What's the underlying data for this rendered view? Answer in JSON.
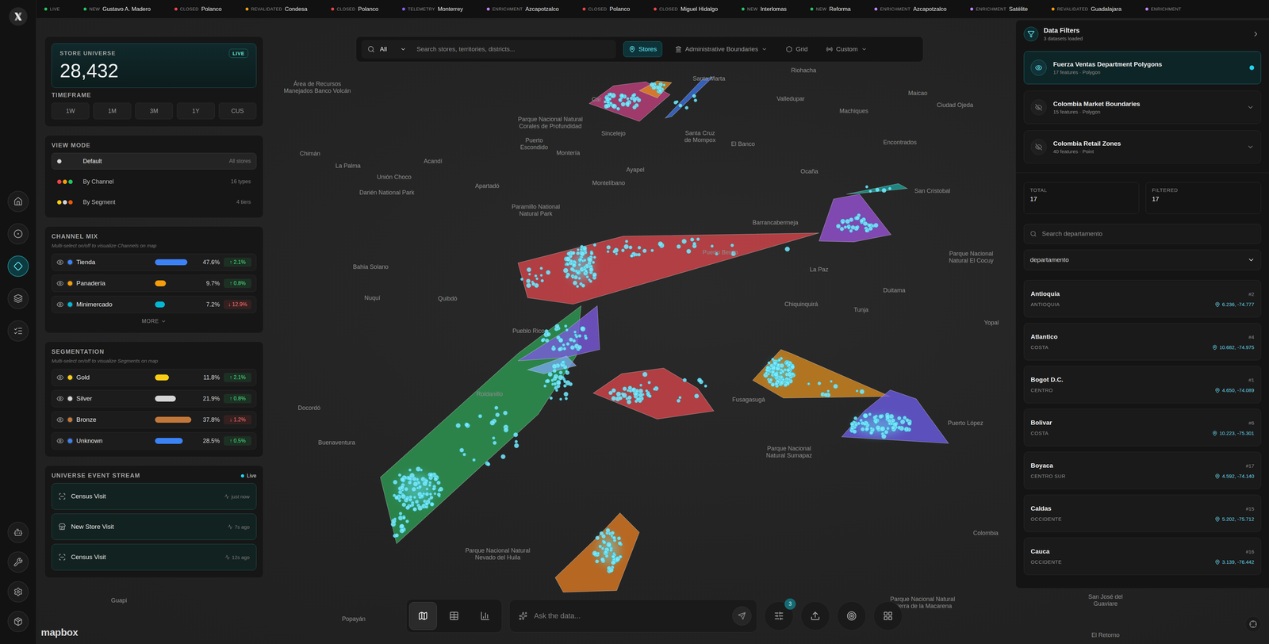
{
  "rail": [
    {
      "selected": false
    },
    {
      "selected": false
    },
    {
      "selected": true
    },
    {
      "selected": false
    },
    {
      "selected": false
    },
    {
      "selected": false
    },
    {
      "selected": false
    },
    {
      "selected": false
    },
    {
      "selected": false
    }
  ],
  "ticker": {
    "live": "LIVE",
    "items": [
      {
        "type": "NEW",
        "place": "Gustavo A. Madero",
        "color": "#22c55e"
      },
      {
        "type": "CLOSED",
        "place": "Polanco",
        "color": "#ef4444"
      },
      {
        "type": "REVALIDATED",
        "place": "Condesa",
        "color": "#f59e0b"
      },
      {
        "type": "CLOSED",
        "place": "Polanco",
        "color": "#ef4444"
      },
      {
        "type": "TELEMETRY",
        "place": "Monterrey",
        "color": "#8b5cf6"
      },
      {
        "type": "ENRICHMENT",
        "place": "Azcapotzalco",
        "color": "#c084fc"
      },
      {
        "type": "CLOSED",
        "place": "Polanco",
        "color": "#ef4444"
      },
      {
        "type": "CLOSED",
        "place": "Miguel Hidalgo",
        "color": "#ef4444"
      },
      {
        "type": "NEW",
        "place": "Interlomas",
        "color": "#22c55e"
      },
      {
        "type": "NEW",
        "place": "Reforma",
        "color": "#22c55e"
      },
      {
        "type": "ENRICHMENT",
        "place": "Azcapotzalco",
        "color": "#c084fc"
      },
      {
        "type": "ENRICHMENT",
        "place": "Satélite",
        "color": "#c084fc"
      },
      {
        "type": "REVALIDATED",
        "place": "Guadalajara",
        "color": "#f59e0b"
      },
      {
        "type": "ENRICHMENT",
        "place": "",
        "color": "#c084fc"
      }
    ]
  },
  "universe": {
    "label": "STORE UNIVERSE",
    "badge": "LIVE",
    "count": "28,432"
  },
  "timeframe": {
    "label": "TIMEFRAME",
    "options": [
      "1W",
      "1M",
      "3M",
      "1Y",
      "CUS"
    ]
  },
  "view_mode": {
    "title": "VIEW MODE",
    "options": [
      {
        "label": "Default",
        "meta": "All stores",
        "selected": true,
        "dots": [
          "#d4d4d4"
        ]
      },
      {
        "label": "By Channel",
        "meta": "16 types",
        "selected": false,
        "dots": [
          "#ef4444",
          "#f59e0b",
          "#22c55e"
        ]
      },
      {
        "label": "By Segment",
        "meta": "4 tiers",
        "selected": false,
        "dots": [
          "#facc15",
          "#d4d4d4",
          "#ea580c"
        ]
      }
    ]
  },
  "channel_mix": {
    "title": "CHANNEL MIX",
    "subtitle": "Multi-select on/off to visualize Channels on map",
    "rows": [
      {
        "name": "Tienda",
        "visible": true,
        "color": "#3b82f6",
        "level": 0.89,
        "share": "47.6%",
        "change": "↑ 2.1%",
        "trend": "up"
      },
      {
        "name": "Panadería",
        "visible": true,
        "color": "#f59e0b",
        "level": 0.3,
        "share": "9.7%",
        "change": "↑ 0.8%",
        "trend": "up"
      },
      {
        "name": "Minimercado",
        "visible": true,
        "color": "#06b6d4",
        "level": 0.27,
        "share": "7.2%",
        "change": "↓ 12.9%",
        "trend": "down"
      }
    ],
    "more": "MORE"
  },
  "segmentation": {
    "title": "SEGMENTATION",
    "subtitle": "Multi-select on/off to visualize Segments on map",
    "rows": [
      {
        "name": "Gold",
        "visible": true,
        "color": "#facc15",
        "level": 0.38,
        "share": "11.8%",
        "change": "↑ 2.1%",
        "trend": "up"
      },
      {
        "name": "Silver",
        "visible": true,
        "color": "#d4d4d4",
        "level": 0.57,
        "share": "21.9%",
        "change": "↑ 0.8%",
        "trend": "up"
      },
      {
        "name": "Bronze",
        "visible": true,
        "color": "#c2773a",
        "level": 1.0,
        "share": "37.8%",
        "change": "↓ 1.2%",
        "trend": "down"
      },
      {
        "name": "Unknown",
        "visible": true,
        "color": "#3b82f6",
        "level": 0.76,
        "share": "28.5%",
        "change": "↑ 0.5%",
        "trend": "up"
      }
    ]
  },
  "event_stream": {
    "title": "UNIVERSE EVENT STREAM",
    "status": "Live",
    "events": [
      {
        "title": "Census Visit",
        "time": "just now",
        "kind": "census"
      },
      {
        "title": "New Store Visit",
        "time": "7s ago",
        "kind": "store"
      },
      {
        "title": "Census Visit",
        "time": "12s ago",
        "kind": "census"
      }
    ]
  },
  "search": {
    "scope": "All",
    "placeholder": "Search stores, territories, districts...",
    "layers": [
      {
        "label": "Stores",
        "selected": true,
        "kind": "toggle"
      },
      {
        "label": "Administrative Boundaries",
        "selected": false,
        "kind": "menu"
      },
      {
        "label": "Grid",
        "selected": false,
        "kind": "toggle"
      },
      {
        "label": "Custom",
        "selected": false,
        "kind": "menu"
      }
    ]
  },
  "data_filters": {
    "title": "Data Filters",
    "subtitle": "3 datasets loaded",
    "datasets": [
      {
        "name": "Fuerza Ventas Department Polygons",
        "meta": "17 features · Polygon",
        "visible": true,
        "selected": true
      },
      {
        "name": "Colombia Market Boundaries",
        "meta": "15 features · Polygon",
        "visible": false,
        "selected": false
      },
      {
        "name": "Colombia Retail Zones",
        "meta": "40 features · Point",
        "visible": false,
        "selected": false
      }
    ],
    "stats": [
      {
        "label": "TOTAL",
        "value": "17"
      },
      {
        "label": "FILTERED",
        "value": "17"
      }
    ],
    "search_placeholder": "Search departamento",
    "group_by": "departamento",
    "items": [
      {
        "name": "Antioquia",
        "rank": "#2",
        "region": "ANTIOQUIA",
        "coords": "6.236, -74.777"
      },
      {
        "name": "Atlantico",
        "rank": "#4",
        "region": "COSTA",
        "coords": "10.682, -74.975"
      },
      {
        "name": "Bogot D.C.",
        "rank": "#1",
        "region": "CENTRO",
        "coords": "4.650, -74.089"
      },
      {
        "name": "Bolivar",
        "rank": "#6",
        "region": "COSTA",
        "coords": "10.223, -75.301"
      },
      {
        "name": "Boyaca",
        "rank": "#17",
        "region": "CENTRO SUR",
        "coords": "4.592, -74.140"
      },
      {
        "name": "Caldas",
        "rank": "#15",
        "region": "OCCIDENTE",
        "coords": "5.202, -75.712"
      },
      {
        "name": "Cauca",
        "rank": "#16",
        "region": "OCCIDENTE",
        "coords": "3.139, -76.442"
      }
    ]
  },
  "toolbar": {
    "views": [
      {
        "selected": true
      },
      {
        "selected": false
      },
      {
        "selected": false
      }
    ],
    "ask_placeholder": "Ask the data...",
    "filter_badge": "3"
  },
  "map": {
    "attribution": "mapbox",
    "regions": [
      {
        "color": "#c2407f"
      },
      {
        "color": "#e08a1e"
      },
      {
        "color": "#3b6fe0"
      },
      {
        "color": "#1aa39a"
      },
      {
        "color": "#9a52d8"
      },
      {
        "color": "#d9454a"
      },
      {
        "color": "#2e9e55"
      },
      {
        "color": "#7c5ae0"
      },
      {
        "color": "#7aa7f0"
      },
      {
        "color": "#d9454a"
      },
      {
        "color": "#d98a1f"
      },
      {
        "color": "#6b5ce7"
      },
      {
        "color": "#e07b22"
      }
    ],
    "labels": [
      {
        "lines": [
          "Área de Recursos",
          "Manejados Banco Volcán"
        ]
      },
      {
        "lines": [
          "Riohacha"
        ]
      },
      {
        "lines": [
          "Santa Marta"
        ]
      },
      {
        "lines": [
          "Maicao"
        ]
      },
      {
        "lines": [
          "Valledupar"
        ]
      },
      {
        "lines": [
          "Ciudad Ojeda"
        ]
      },
      {
        "lines": [
          "Machiques"
        ]
      },
      {
        "lines": [
          "Car"
        ]
      },
      {
        "lines": [
          "Parque Nacional Natural",
          "Corales de Profundidad"
        ]
      },
      {
        "lines": [
          "Sincelejo"
        ]
      },
      {
        "lines": [
          "Santa Cruz",
          "de Mompox"
        ]
      },
      {
        "lines": [
          "El Banco"
        ]
      },
      {
        "lines": [
          "Encontrados"
        ]
      },
      {
        "lines": [
          "Puerto",
          "Escondido"
        ]
      },
      {
        "lines": [
          "Montería"
        ]
      },
      {
        "lines": [
          "Chimán"
        ]
      },
      {
        "lines": [
          "La Palma"
        ]
      },
      {
        "lines": [
          "Acandí"
        ]
      },
      {
        "lines": [
          "Unión Choco"
        ]
      },
      {
        "lines": [
          "Darién National Park"
        ]
      },
      {
        "lines": [
          "Apartadó"
        ]
      },
      {
        "lines": [
          "Ayapel"
        ]
      },
      {
        "lines": [
          "Montelíbano"
        ]
      },
      {
        "lines": [
          "Ocaña"
        ]
      },
      {
        "lines": [
          "Paramillo National",
          "Natural Park"
        ]
      },
      {
        "lines": [
          "Barrancabermeja"
        ]
      },
      {
        "lines": [
          "San Cristobal"
        ]
      },
      {
        "lines": [
          "Puerto Berrío"
        ]
      },
      {
        "lines": [
          "La Paz"
        ]
      },
      {
        "lines": [
          "Parque Nacional",
          "Natural El Cocuy"
        ]
      },
      {
        "lines": [
          "Bahia Solano"
        ]
      },
      {
        "lines": [
          "Duitama"
        ]
      },
      {
        "lines": [
          "Nuquí"
        ]
      },
      {
        "lines": [
          "Quibdó"
        ]
      },
      {
        "lines": [
          "Chiquinquirá"
        ]
      },
      {
        "lines": [
          "Tunja"
        ]
      },
      {
        "lines": [
          "Yopal"
        ]
      },
      {
        "lines": [
          "Pueblo Rico"
        ]
      },
      {
        "lines": [
          "Roldanillo"
        ]
      },
      {
        "lines": [
          "Docordó"
        ]
      },
      {
        "lines": [
          "Fusagasugá"
        ]
      },
      {
        "lines": [
          "Puerto López"
        ]
      },
      {
        "lines": [
          "Buenaventura"
        ]
      },
      {
        "lines": [
          "Parque Nacional",
          "Natural Sumapaz"
        ]
      },
      {
        "lines": [
          "Colombia"
        ]
      },
      {
        "lines": [
          "Parque Nacional Natural",
          "Nevado del Huila"
        ]
      },
      {
        "lines": [
          "Guapi"
        ]
      },
      {
        "lines": [
          "Parque Nacional Natural",
          "Sierra de la Macarena"
        ]
      },
      {
        "lines": [
          "San José del",
          "Guaviare"
        ]
      },
      {
        "lines": [
          "Popayán"
        ]
      },
      {
        "lines": [
          "El Retorno"
        ]
      }
    ]
  }
}
